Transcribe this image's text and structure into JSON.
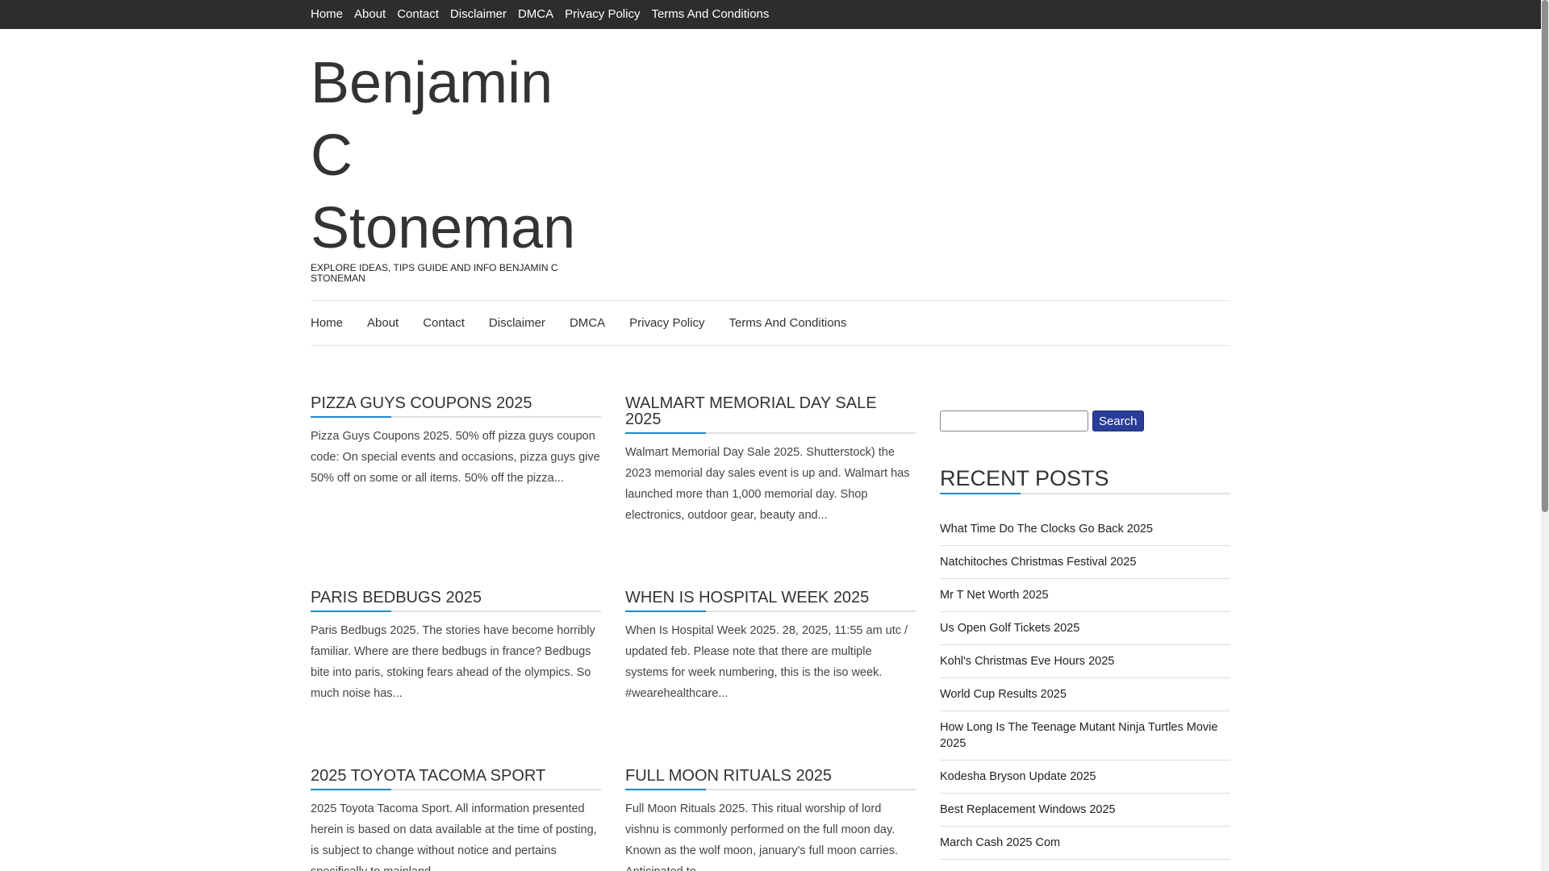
{
  "top_nav": [
    "Home",
    "About",
    "Contact",
    "Disclaimer",
    "DMCA",
    "Privacy Policy",
    "Terms And Conditions"
  ],
  "site": {
    "title_line1": "Benjamin",
    "title_line2": "C",
    "title_line3": "Stoneman",
    "description": "EXPLORE IDEAS, TIPS GUIDE AND INFO BENJAMIN C STONEMAN"
  },
  "main_nav": [
    "Home",
    "About",
    "Contact",
    "Disclaimer",
    "DMCA",
    "Privacy Policy",
    "Terms And Conditions"
  ],
  "posts": [
    {
      "title": "PIZZA GUYS COUPONS 2025",
      "excerpt": "Pizza Guys Coupons 2025. 50% off pizza guys coupon code: On special events and occasions, pizza guys give 50% off on some or all items. 50% off the pizza..."
    },
    {
      "title": "WALMART MEMORIAL DAY SALE 2025",
      "excerpt": "Walmart Memorial Day Sale 2025. Shutterstock) the 2023 memorial day sales event is up and. Walmart has launched more than 1,000 memorial day. Shop electronics, outdoor gear, beauty and..."
    },
    {
      "title": "PARIS BEDBUGS 2025",
      "excerpt": "Paris Bedbugs 2025. The stories have become horribly familiar. Where are there bedbugs in france? Bedbugs bite into paris, stoking fears ahead of the olympics. So much noise has..."
    },
    {
      "title": "WHEN IS HOSPITAL WEEK 2025",
      "excerpt": "When Is Hospital Week 2025. 28, 2025, 11:55 am utc / updated feb. Please note that there are multiple systems for week numbering, this is the iso week. #wearehealthcare..."
    },
    {
      "title": "2025 TOYOTA TACOMA SPORT",
      "excerpt": "2025 Toyota Tacoma Sport. All information presented herein is based on data available at the time of posting, is subject to change without notice and pertains specifically to mainland..."
    },
    {
      "title": "FULL MOON RITUALS 2025",
      "excerpt": "Full Moon Rituals 2025. This ritual worship of lord vishnu is commonly performed on the full moon day. Known as the wolf moon, january's full moon carries. Anticipated to..."
    }
  ],
  "search": {
    "button_label": "Search",
    "value": ""
  },
  "recent_posts": {
    "title": "RECENT POSTS",
    "items": [
      "What Time Do The Clocks Go Back 2025",
      "Natchitoches Christmas Festival 2025",
      "Mr T Net Worth 2025",
      "Us Open Golf Tickets 2025",
      "Kohl's Christmas Eve Hours 2025",
      "World Cup Results 2025",
      "How Long Is The Teenage Mutant Ninja Turtles Movie 2025",
      "Kodesha Bryson Update 2025",
      "Best Replacement Windows 2025",
      "March Cash 2025 Com"
    ]
  },
  "colors": {
    "topbar": "#2d2d2d",
    "accent": "#1e88c8",
    "search_button": "#2a3d9a"
  }
}
